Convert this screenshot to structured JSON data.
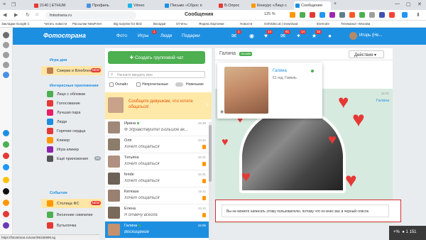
{
  "browser": {
    "tabs": [
      {
        "label": "2140 | ETHUM",
        "color": "#e53935"
      },
      {
        "label": "Профиль",
        "color": "#4a90e2"
      },
      {
        "label": "Vimeo",
        "color": "#1ab7ea"
      },
      {
        "label": "Письмо «Сброс п",
        "color": "#1d8fe1"
      },
      {
        "label": "В.Опрос",
        "color": "#e53935"
      },
      {
        "label": "Конкурс «Лицо с",
        "color": "#ff9800"
      },
      {
        "label": "Сообщения",
        "color": "#1d8fe1"
      }
    ],
    "url": "fotostrana.ru",
    "page_title": "Сообщения",
    "zoom": "125 %",
    "status_url": "https://fotostrana.ru/user/99155995.sg",
    "bookmarks": [
      "Закладки Google C",
      "Читать новости",
      "Рассылки NewFreer",
      "Big surprise for Bird",
      "Вкладки",
      "Отчеты",
      "Яндекс.Картинки",
      "Новости",
      "GetVideo.at | Download",
      "Evernote",
      "Телеканал «Москва"
    ]
  },
  "site": {
    "logo": "Фотострана",
    "nav": [
      {
        "label": "Фото"
      },
      {
        "label": "Игры",
        "badge": "1"
      },
      {
        "label": "Люди"
      },
      {
        "label": "Подарки"
      }
    ],
    "header_badges": [
      "1",
      "14",
      "61",
      "14",
      "15"
    ],
    "user_name": "Игорь (Не..."
  },
  "sidebar": {
    "section_games": "Игра дня",
    "game_item": {
      "label": "Смерки и Влюблени",
      "badge": "NEW"
    },
    "section_apps": "Интересные приложения",
    "apps": [
      {
        "label": "Лицо с обложки",
        "color": "#4caf50"
      },
      {
        "label": "Голосование",
        "color": "#e53935"
      },
      {
        "label": "Лучшая пара",
        "color": "#e91e63"
      },
      {
        "label": "Люди",
        "color": "#1d8fe1"
      },
      {
        "label": "Горячие сердца",
        "color": "#e53935"
      },
      {
        "label": "Кликер",
        "color": "#ff9800"
      },
      {
        "label": "Игра кликер",
        "color": "#8e24aa"
      },
      {
        "label": "Ещё приложения",
        "color": "#555",
        "count": "33"
      }
    ],
    "section_events": "События",
    "events": [
      {
        "label": "Столица ФС",
        "badge": "NEW",
        "color": "#ff9800"
      },
      {
        "label": "Весенние симпатии",
        "color": "#4caf50"
      },
      {
        "label": "Бутылочка",
        "color": "#e53935"
      }
    ]
  },
  "conversations": {
    "group_button": "Создать групповой чат",
    "search_placeholder": "Начните вводить имя",
    "filters": {
      "online": "Онлайн",
      "unread": "Непрочитанные",
      "new": "Новенькие"
    },
    "promo": "Сообщите девушкам, что хотите общаться!",
    "items": [
      {
        "name": "Ирина",
        "message": "Ф Здравствуйте! Большое вк...",
        "time": "15:39",
        "active": false,
        "online": true
      },
      {
        "name": "Оля",
        "message": "Хочет общаться",
        "time": "15:32",
        "active": false,
        "mark": true
      },
      {
        "name": "Татьяна",
        "message": "Хочет общаться",
        "time": "15:31",
        "active": false,
        "mark": true
      },
      {
        "name": "feride",
        "message": "Хочет общаться",
        "time": "15:31",
        "active": false,
        "mark": true
      },
      {
        "name": "Катюша",
        "message": "Хочет общаться",
        "time": "15:11",
        "active": false,
        "mark": true
      },
      {
        "name": "Елена",
        "message": "Я отвечу всегда",
        "time": "15:10",
        "active": false,
        "mark": true
      },
      {
        "name": "Галина",
        "message": "Восхищение",
        "time": "15:05",
        "active": true,
        "online": true
      }
    ]
  },
  "chat": {
    "name": "Галина",
    "online_label": "Онлайн",
    "actions_label": "Действия",
    "message_time": "16:01",
    "message_sender": "Галина",
    "profile": {
      "name": "Галина",
      "meta": "61 год, Гомель"
    },
    "blocked_text": "Вы не можете написать этому пользователю, потому что он внес вас в черный список."
  },
  "counter": {
    "icon": "+%",
    "value": "1 151"
  }
}
